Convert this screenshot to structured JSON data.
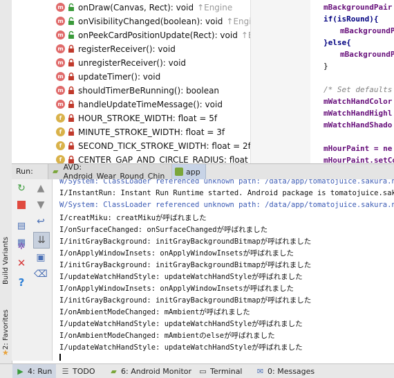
{
  "left_strip": {
    "build_variants_label": "Build Variants",
    "favorites_label": "2: Favorites"
  },
  "structure": {
    "items": [
      {
        "kind": "m",
        "label": "onDraw(Canvas, Rect): void",
        "inherit": "↑Engine",
        "vis": "open"
      },
      {
        "kind": "m",
        "label": "onVisibilityChanged(boolean): void",
        "inherit": "↑Engine",
        "vis": "open"
      },
      {
        "kind": "m",
        "label": "onPeekCardPositionUpdate(Rect): void",
        "inherit": "↑Engi",
        "vis": "open"
      },
      {
        "kind": "m",
        "label": "registerReceiver(): void",
        "inherit": "",
        "vis": "lock"
      },
      {
        "kind": "m",
        "label": "unregisterReceiver(): void",
        "inherit": "",
        "vis": "lock"
      },
      {
        "kind": "m",
        "label": "updateTimer(): void",
        "inherit": "",
        "vis": "lock"
      },
      {
        "kind": "m",
        "label": "shouldTimerBeRunning(): boolean",
        "inherit": "",
        "vis": "lock"
      },
      {
        "kind": "m",
        "label": "handleUpdateTimeMessage(): void",
        "inherit": "",
        "vis": "lock"
      },
      {
        "kind": "f",
        "label": "HOUR_STROKE_WIDTH: float = 5f",
        "inherit": "",
        "vis": "lock"
      },
      {
        "kind": "f",
        "label": "MINUTE_STROKE_WIDTH: float = 3f",
        "inherit": "",
        "vis": "lock"
      },
      {
        "kind": "f",
        "label": "SECOND_TICK_STROKE_WIDTH: float = 2f",
        "inherit": "",
        "vis": "lock"
      },
      {
        "kind": "f",
        "label": "CENTER_GAP_AND_CIRCLE_RADIUS: float = 4f",
        "inherit": "",
        "vis": "lock"
      }
    ]
  },
  "editor": {
    "lines": [
      {
        "text": "mBackgroundPair",
        "cls": "fld",
        "indent": 0
      },
      {
        "text": "if(isRound){",
        "cls": "kw",
        "indent": 0
      },
      {
        "text": "mBackgroundP",
        "cls": "fld",
        "indent": 1
      },
      {
        "text": "}else{",
        "cls": "kw",
        "indent": 0
      },
      {
        "text": "mBackgroundP",
        "cls": "fld",
        "indent": 1
      },
      {
        "text": "}",
        "cls": "",
        "indent": 0
      },
      {
        "text": "",
        "cls": "",
        "indent": 0
      },
      {
        "text": "/* Set defaults",
        "cls": "cmt",
        "indent": 0
      },
      {
        "text": "mWatchHandColor",
        "cls": "fld",
        "indent": 0
      },
      {
        "text": "mWatchHandHighl",
        "cls": "fld",
        "indent": 0
      },
      {
        "text": "mWatchHandShado",
        "cls": "fld",
        "indent": 0
      },
      {
        "text": "",
        "cls": "",
        "indent": 0
      },
      {
        "text": "mHourPaint = ne",
        "cls": "fld",
        "indent": 0
      },
      {
        "text": "mHourPaint.setCo",
        "cls": "fld",
        "indent": 0
      }
    ]
  },
  "run_bar": {
    "label": "Run:",
    "tabs": [
      {
        "label": "AVD: Android_Wear_Round_Chin"
      },
      {
        "label": "app"
      }
    ]
  },
  "console": {
    "lines": [
      {
        "text": "W/System: ClassLoader referenced unknown path: /data/app/tomatojuice.sakura.ne.jp",
        "sys": true
      },
      {
        "text": "I/InstantRun: Instant Run Runtime started. Android package is tomatojuice.sakura.",
        "sys": false
      },
      {
        "text": "W/System: ClassLoader referenced unknown path: /data/app/tomatojuice.sakura.ne.jp",
        "sys": true
      },
      {
        "text": "I/creatMiku: creatMikuが呼ばれました",
        "sys": false
      },
      {
        "text": "I/onSurfaceChanged: onSurfaceChangedが呼ばれました",
        "sys": false
      },
      {
        "text": "I/initGrayBackground: initGrayBackgroundBitmapが呼ばれました",
        "sys": false
      },
      {
        "text": "I/onApplyWindowInsets: onApplyWindowInsetsが呼ばれました",
        "sys": false
      },
      {
        "text": "I/initGrayBackground: initGrayBackgroundBitmapが呼ばれました",
        "sys": false
      },
      {
        "text": "I/updateWatchHandStyle: updateWatchHandStyleが呼ばれました",
        "sys": false
      },
      {
        "text": "I/onApplyWindowInsets: onApplyWindowInsetsが呼ばれました",
        "sys": false
      },
      {
        "text": "I/initGrayBackground: initGrayBackgroundBitmapが呼ばれました",
        "sys": false
      },
      {
        "text": "I/onAmbientModeChanged: mAmbientが呼ばれました",
        "sys": false
      },
      {
        "text": "I/updateWatchHandStyle: updateWatchHandStyleが呼ばれました",
        "sys": false
      },
      {
        "text": "I/onAmbientModeChanged: mAmbientのelseが呼ばれました",
        "sys": false
      },
      {
        "text": "I/updateWatchHandStyle: updateWatchHandStyleが呼ばれました",
        "sys": false
      }
    ]
  },
  "bottom_bar": {
    "run": "4: Run",
    "todo": "TODO",
    "android_monitor": "6: Android Monitor",
    "terminal": "Terminal",
    "messages": "0: Messages"
  },
  "colors": {
    "method_icon": "#e06a6a",
    "field_icon": "#d9b24a",
    "lock": "#c0392b",
    "open_lock": "#3a9a3a",
    "run_green": "#4caf50",
    "stop_red": "#e04a3f",
    "system_log_blue": "#3b5bb5"
  }
}
